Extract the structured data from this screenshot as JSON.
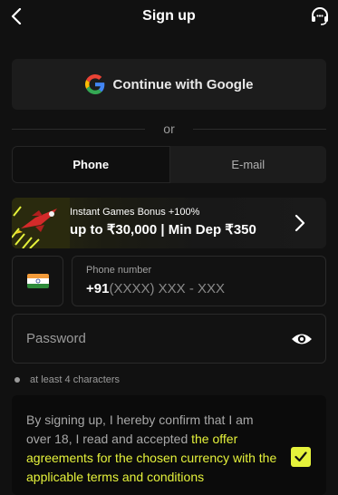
{
  "header": {
    "title": "Sign up",
    "back_icon": "chevron-left-icon",
    "support_icon": "headset-icon"
  },
  "google_button": {
    "label": "Continue with Google",
    "icon": "google-icon"
  },
  "divider": {
    "text": "or"
  },
  "tabs": [
    {
      "label": "Phone",
      "active": true
    },
    {
      "label": "E-mail",
      "active": false
    }
  ],
  "bonus": {
    "small_text": "Instant Games Bonus +100%",
    "big_text": "up to ₹30,000 | Min Dep ₹350",
    "icon": "chevron-right-icon"
  },
  "phone": {
    "flag": "india-flag-icon",
    "label": "Phone number",
    "prefix": "+91",
    "mask": "(XXXX) XXX - XXX"
  },
  "password": {
    "placeholder": "Password",
    "icon": "eye-icon",
    "hint": "at least 4 characters"
  },
  "terms": {
    "text_plain": "By signing up, I hereby confirm that I am over 18, I read and accepted ",
    "text_link": "the offer agreements for the chosen currency with the applicable terms and conditions",
    "checked": true
  },
  "colors": {
    "accent": "#e5f23b",
    "background": "#111111",
    "surface": "#1c1c1c"
  }
}
